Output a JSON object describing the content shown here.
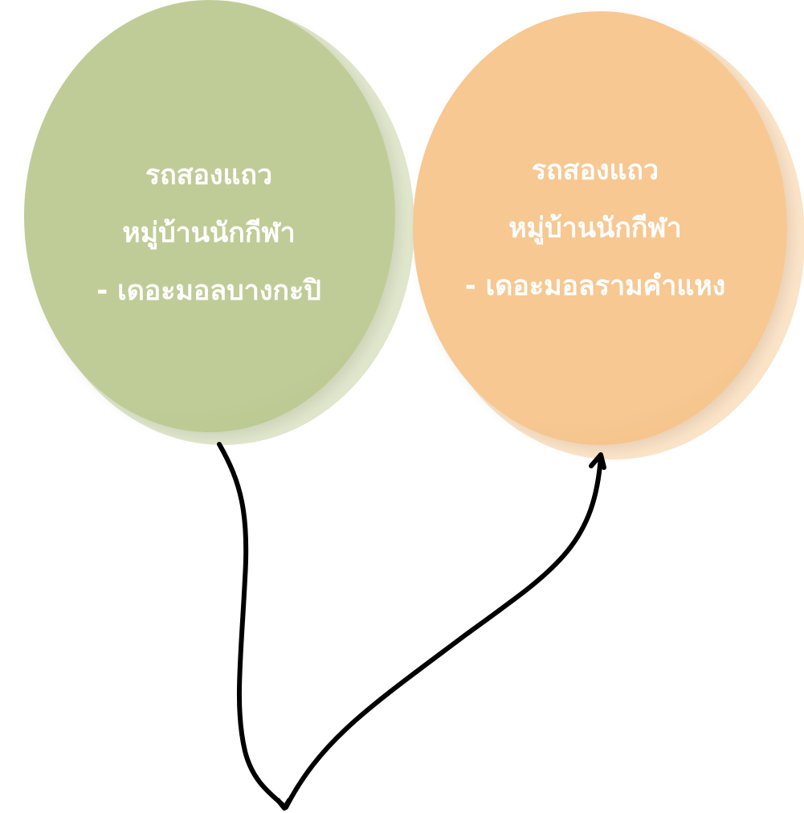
{
  "colors": {
    "left_balloon": "#bfcc97",
    "left_balloon_shadow": "#dfe6cb",
    "right_balloon": "#f7c892",
    "right_balloon_shadow": "#fbe3c7",
    "text": "#ffffff",
    "string": "#000000"
  },
  "balloons": [
    {
      "line1": "รถสองแถว",
      "line2": "หมู่บ้านนักกีฬา",
      "line3": "- เดอะมอลบางกะปิ"
    },
    {
      "line1": "รถสองแถว",
      "line2": "หมู่บ้านนักกีฬา",
      "line3": "- เดอะมอลรามคำแหง"
    }
  ]
}
